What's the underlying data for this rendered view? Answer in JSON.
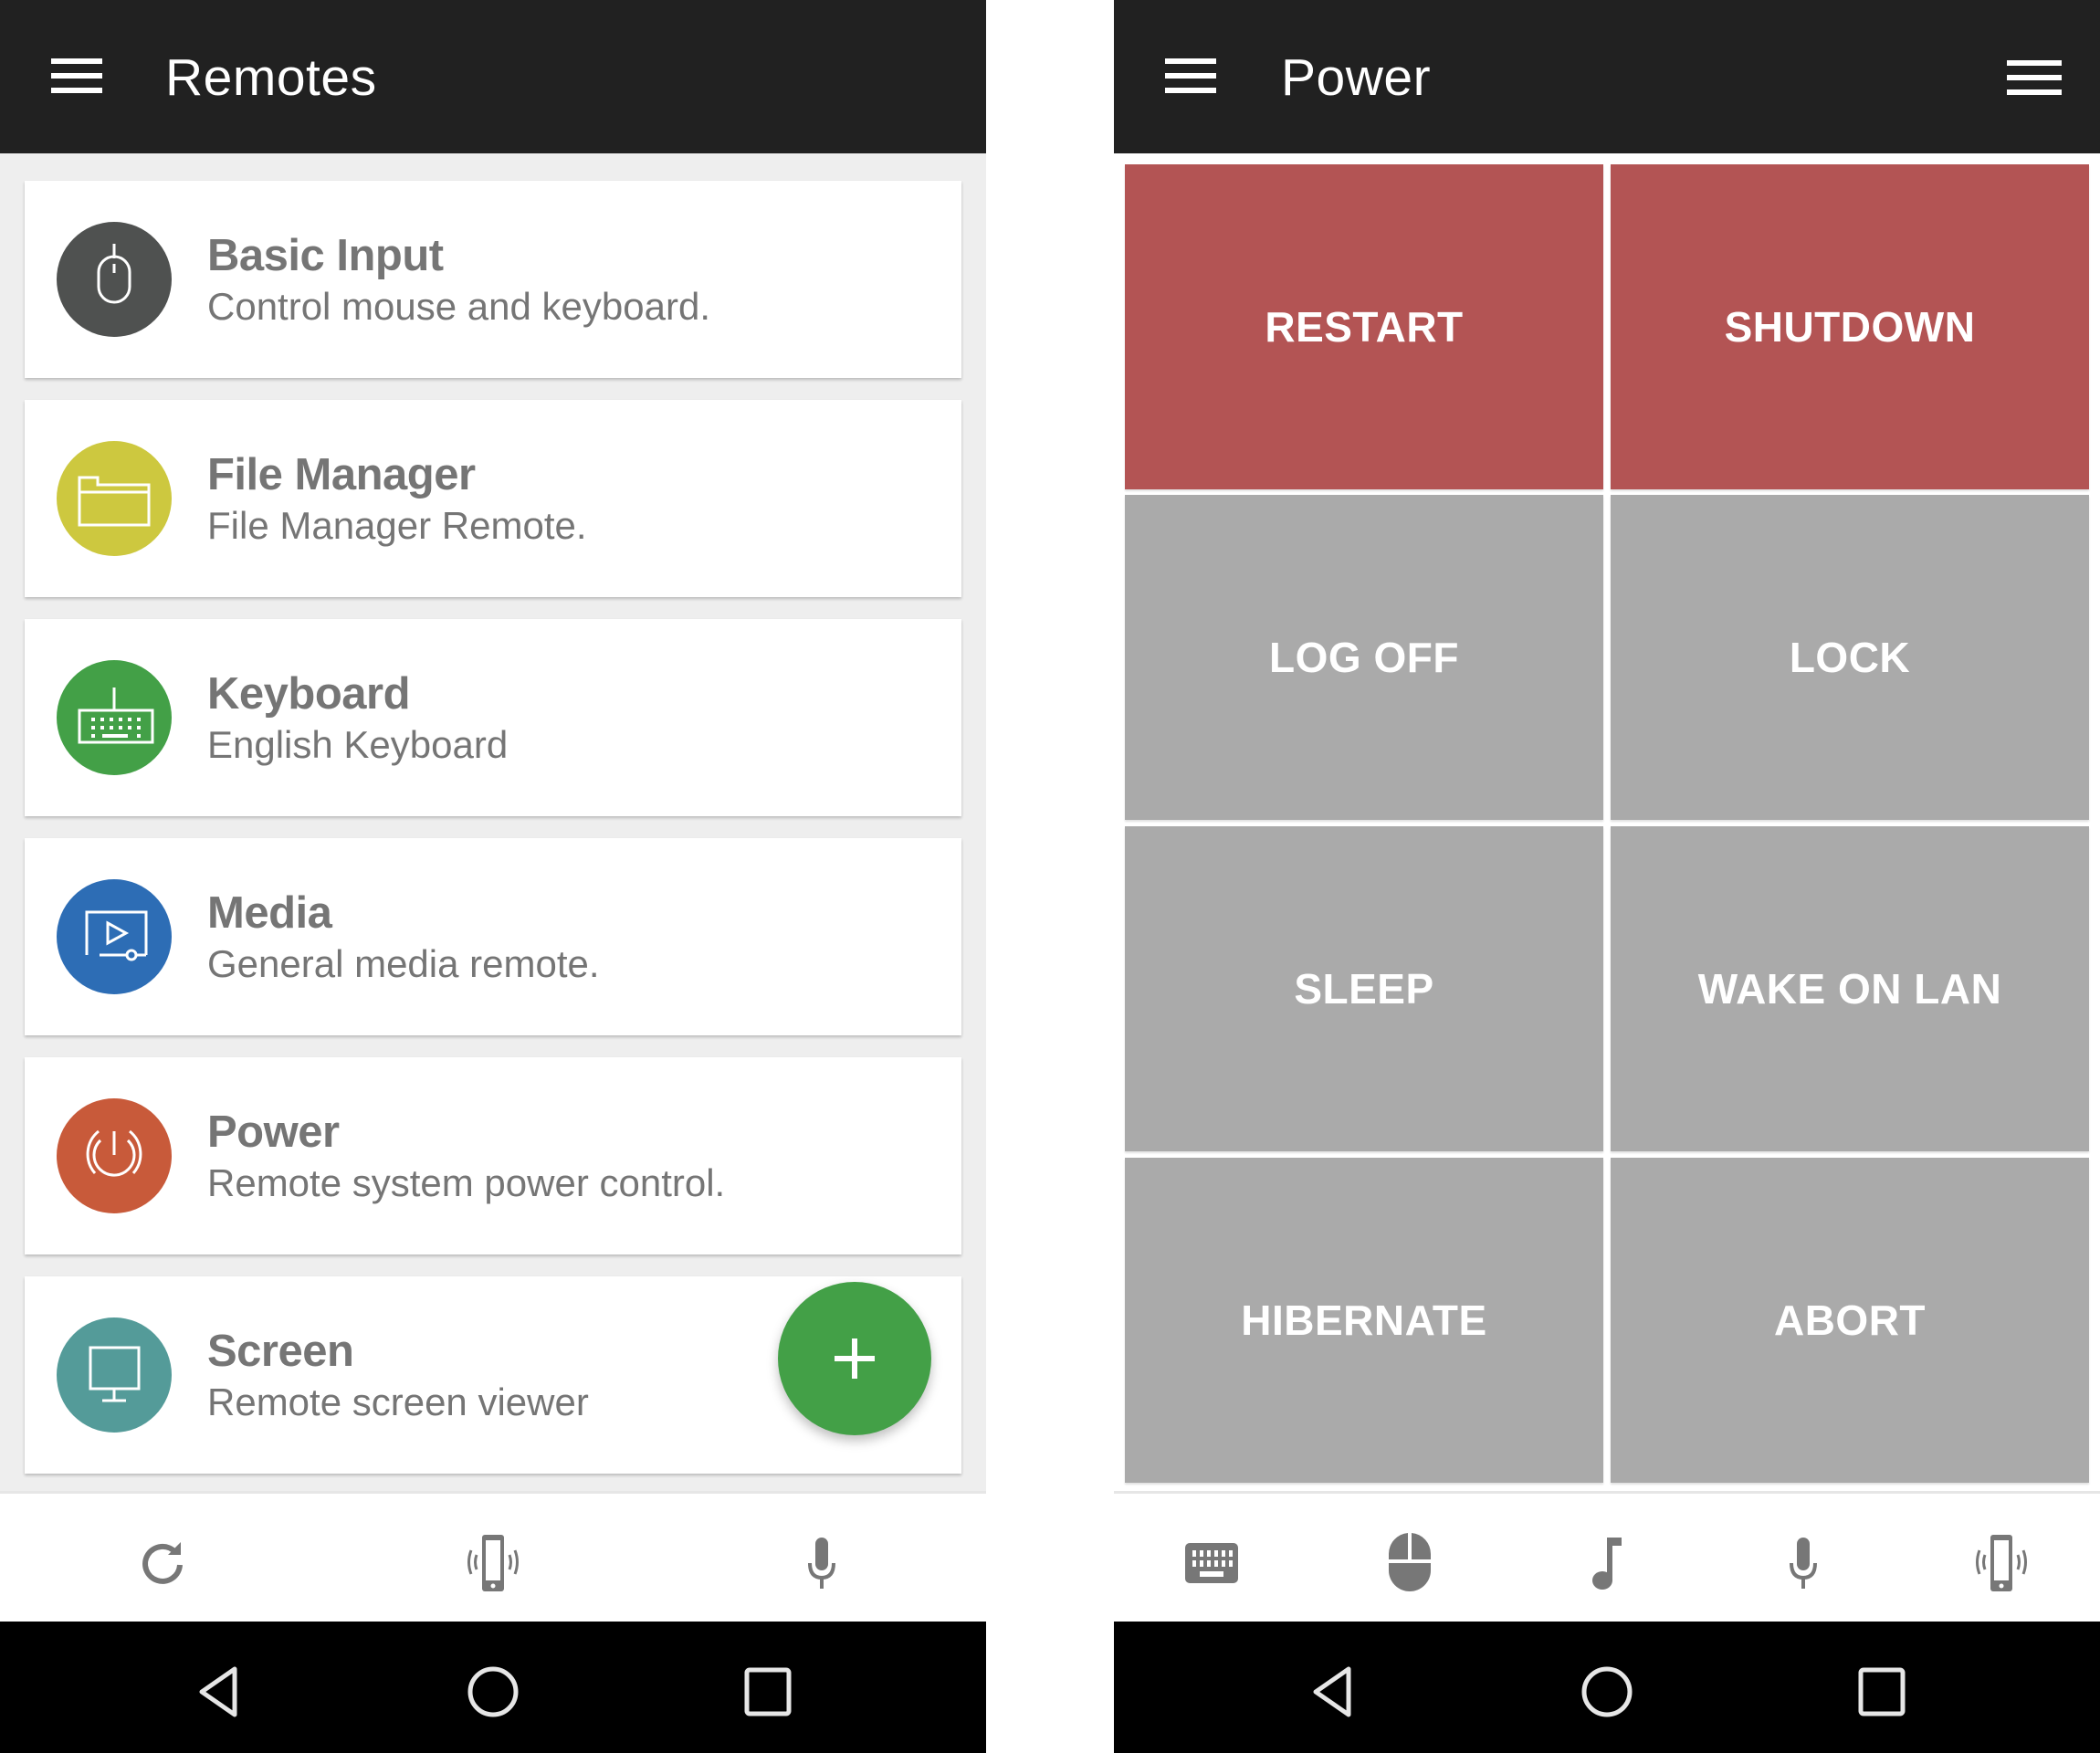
{
  "left_screen": {
    "appbar": {
      "title": "Remotes",
      "menu_icon": "hamburger-menu-icon"
    },
    "remotes": [
      {
        "title": "Basic Input",
        "subtitle": "Control mouse and keyboard.",
        "icon": "mouse-icon",
        "color": "#4f5150"
      },
      {
        "title": "File Manager",
        "subtitle": "File Manager Remote.",
        "icon": "folder-icon",
        "color": "#cdc83f"
      },
      {
        "title": "Keyboard",
        "subtitle": "English Keyboard",
        "icon": "keyboard-icon",
        "color": "#43a047"
      },
      {
        "title": "Media",
        "subtitle": "General media remote.",
        "icon": "media-player-icon",
        "color": "#2d6db5"
      },
      {
        "title": "Power",
        "subtitle": "Remote system power control.",
        "icon": "power-icon",
        "color": "#c85a3a"
      },
      {
        "title": "Screen",
        "subtitle": "Remote screen viewer",
        "icon": "monitor-icon",
        "color": "#549b99"
      }
    ],
    "fab": {
      "icon": "plus-icon",
      "color": "#43a047"
    },
    "toolbar": [
      "refresh-icon",
      "vibrate-phone-icon",
      "microphone-icon"
    ]
  },
  "right_screen": {
    "appbar": {
      "title": "Power",
      "menu_icon": "hamburger-menu-icon",
      "overflow_icon": "list-menu-icon"
    },
    "buttons": [
      {
        "label": "RESTART",
        "color": "#b35454"
      },
      {
        "label": "SHUTDOWN",
        "color": "#b35454"
      },
      {
        "label": "LOG OFF",
        "color": "#aaaaaa"
      },
      {
        "label": "LOCK",
        "color": "#aaaaaa"
      },
      {
        "label": "SLEEP",
        "color": "#aaaaaa"
      },
      {
        "label": "WAKE ON LAN",
        "color": "#aaaaaa"
      },
      {
        "label": "HIBERNATE",
        "color": "#aaaaaa"
      },
      {
        "label": "ABORT",
        "color": "#aaaaaa"
      }
    ],
    "toolbar": [
      "keyboard-icon",
      "mouse-icon",
      "music-note-icon",
      "microphone-icon",
      "vibrate-phone-icon"
    ]
  },
  "system_nav": [
    "back-icon",
    "home-icon",
    "recents-icon"
  ],
  "colors": {
    "appbar": "#212121",
    "secondary_text": "#757575",
    "icon_gray": "#777777"
  }
}
